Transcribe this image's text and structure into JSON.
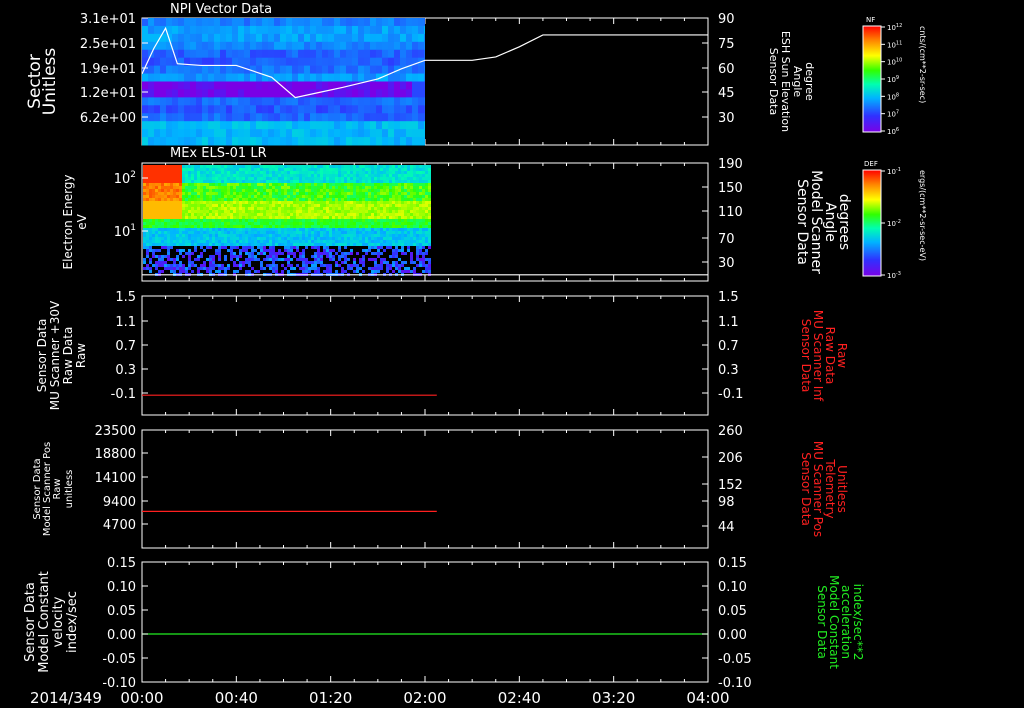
{
  "colors": {
    "white": "#ffffff",
    "red": "#ff2020",
    "green": "#22ee22",
    "bg": "#000000"
  },
  "time_axis": {
    "date_label": "2014/349",
    "ticks": [
      "00:00",
      "00:40",
      "01:20",
      "02:00",
      "02:40",
      "03:20",
      "04:00"
    ]
  },
  "panels": [
    {
      "id": "npi",
      "title": "NPI Vector Data",
      "left_label": [
        "Sector",
        "Unitless"
      ],
      "left_ticks": [
        "3.1e+01",
        "2.5e+01",
        "1.9e+01",
        "1.2e+01",
        "6.2e+00"
      ],
      "right_label": [
        "Sensor Data",
        "ESH Sun Elevation",
        "Angle",
        "degree"
      ],
      "right_ticks": [
        "90",
        "75",
        "60",
        "45",
        "30"
      ]
    },
    {
      "id": "els",
      "title": "MEx ELS-01 LR",
      "left_label": [
        "Electron Energy",
        "eV"
      ],
      "left_ticks": [
        "10",
        "10"
      ],
      "left_tick_exp": [
        "2",
        "1"
      ],
      "right_label": [
        "Sensor Data",
        "Model Scanner",
        "Angle",
        "degrees"
      ],
      "right_ticks": [
        "190",
        "150",
        "110",
        "70",
        "30"
      ]
    },
    {
      "id": "mu_raw",
      "left_label": [
        "Sensor Data",
        "MU Scanner +30V",
        "Raw Data",
        "Raw"
      ],
      "left_ticks": [
        "1.5",
        "1.1",
        "0.7",
        "0.3",
        "-0.1"
      ],
      "right_label": [
        "Sensor Data",
        "MU Scanner Inf",
        "Raw Data",
        "Raw"
      ],
      "right_ticks": [
        "1.5",
        "1.1",
        "0.7",
        "0.3",
        "-0.1"
      ]
    },
    {
      "id": "scanner_pos",
      "left_label": [
        "Sensor Data",
        "Model Scanner Pos",
        "Raw",
        "unitless"
      ],
      "left_ticks": [
        "23500",
        "18800",
        "14100",
        "9400",
        "4700"
      ],
      "right_label": [
        "Sensor Data",
        "MU Scanner Pos",
        "Telemetry",
        "Unitless"
      ],
      "right_ticks": [
        "260",
        "206",
        "152",
        "98",
        "44"
      ]
    },
    {
      "id": "constants",
      "left_label": [
        "Sensor Data",
        "Model Constant",
        "velocity",
        "index/sec"
      ],
      "left_ticks": [
        "0.15",
        "0.10",
        "0.05",
        "0.00",
        "-0.05",
        "-0.10"
      ],
      "right_label": [
        "Sensor Data",
        "Model Constant",
        "acceleration",
        "index/sec**2"
      ],
      "right_ticks": [
        "0.15",
        "0.10",
        "0.05",
        "0.00",
        "-0.05",
        "-0.10"
      ]
    }
  ],
  "colorbars": [
    {
      "name": "NF",
      "units": "cnts/(cm**2-sr-sec)",
      "ticks": [
        "10",
        "10",
        "10",
        "10",
        "10",
        "10",
        "10"
      ],
      "tick_exp": [
        "12",
        "11",
        "10",
        "9",
        "8",
        "7",
        "6"
      ]
    },
    {
      "name": "DEF",
      "units": "ergs/(cm**2-sr-sec-eV)",
      "ticks": [
        "10",
        "10",
        "10"
      ],
      "tick_exp": [
        "-1",
        "-2",
        "-3"
      ]
    }
  ],
  "chart_data": [
    {
      "type": "heatmap",
      "title": "NPI Vector Data",
      "ylabel": "Sector Unitless",
      "y_ticks": [
        31,
        25,
        19,
        12,
        6.2
      ],
      "x_range": [
        "00:00",
        "04:00"
      ],
      "data_extent_x": [
        "00:00",
        "02:00"
      ],
      "colorbar": "NF",
      "overlay_line": {
        "name": "ESH Sun Elevation Angle",
        "ylim": [
          15,
          90
        ],
        "x": [
          "00:00",
          "00:05",
          "00:10",
          "00:15",
          "00:25",
          "00:40",
          "00:55",
          "01:05",
          "01:15",
          "01:25",
          "01:40",
          "01:50",
          "02:00",
          "02:20",
          "02:30",
          "02:40",
          "02:50",
          "03:00",
          "04:00"
        ],
        "y": [
          57,
          72,
          84,
          63,
          62,
          62,
          55,
          43,
          46,
          49,
          54,
          60,
          65,
          65,
          67,
          73,
          80,
          80,
          80
        ]
      }
    },
    {
      "type": "heatmap",
      "title": "MEx ELS-01 LR",
      "ylabel": "Electron Energy eV",
      "yscale": "log",
      "x_range": [
        "00:00",
        "04:00"
      ],
      "data_extent_x": [
        "00:00",
        "02:02"
      ],
      "colorbar": "DEF",
      "overlay_line": {
        "name": "Model Scanner Angle",
        "ylim": [
          0,
          190
        ],
        "x": [
          "00:00",
          "04:00"
        ],
        "y": [
          10,
          10
        ]
      }
    },
    {
      "type": "line",
      "ylim": [
        -0.3,
        1.5
      ],
      "series": [
        {
          "name": "MU Scanner +30V Raw Data",
          "color": "#ff2020",
          "x": [
            "00:00",
            "02:05"
          ],
          "y": [
            0,
            0
          ]
        }
      ]
    },
    {
      "type": "line",
      "ylim": [
        0,
        23500
      ],
      "series": [
        {
          "name": "Model Scanner Pos",
          "color": "#ff2020",
          "x": [
            "00:00",
            "02:05"
          ],
          "y": [
            7300,
            7300
          ]
        }
      ]
    },
    {
      "type": "line",
      "ylim": [
        -0.1,
        0.15
      ],
      "series": [
        {
          "name": "Model Constant velocity",
          "color": "#22ee22",
          "x": [
            "00:00",
            "04:00"
          ],
          "y": [
            0,
            0
          ]
        }
      ]
    }
  ]
}
